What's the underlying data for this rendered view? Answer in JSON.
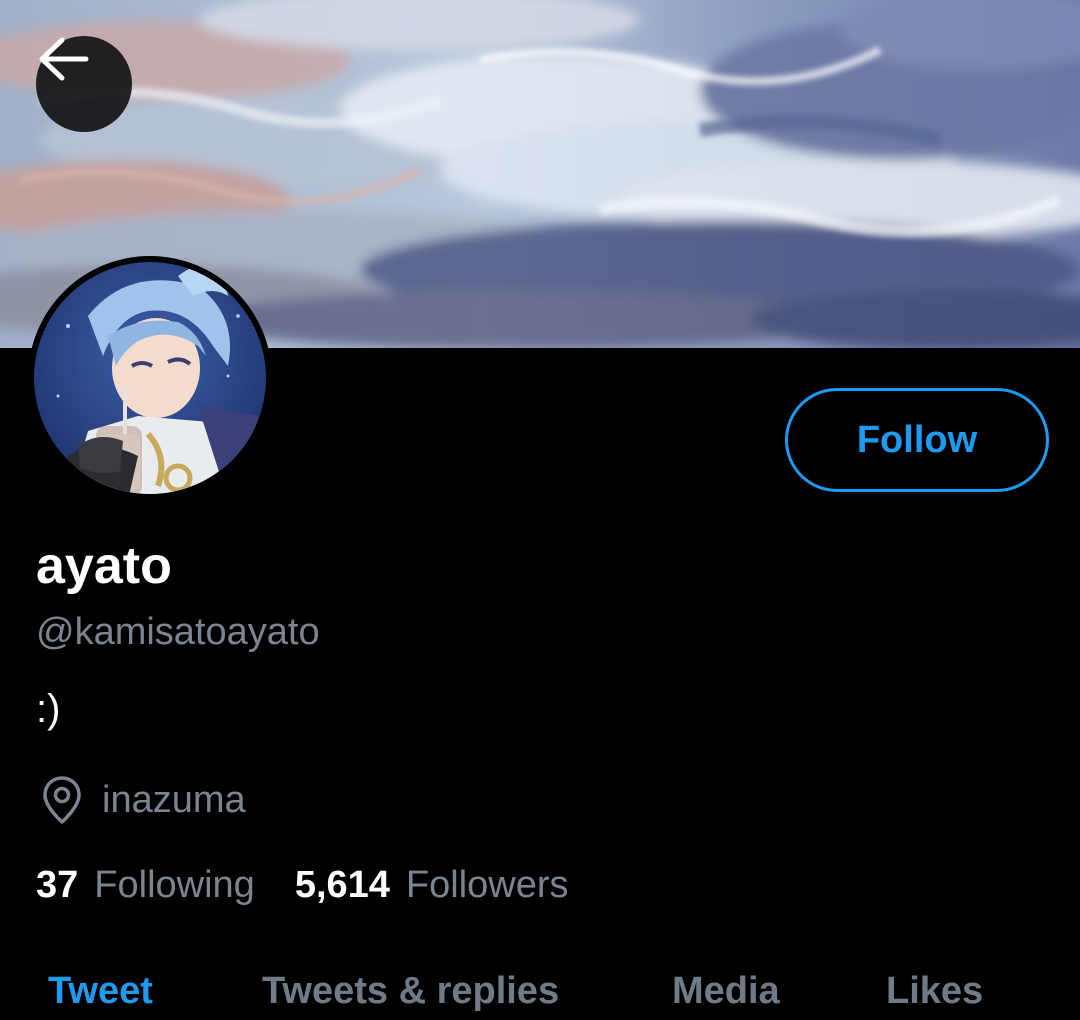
{
  "header": {
    "back_icon": "arrow-left-icon"
  },
  "profile": {
    "display_name": "ayato",
    "handle": "@kamisatoayato",
    "bio": ":)",
    "location_icon": "location-pin-icon",
    "location": "inazuma",
    "follow_label": "Follow"
  },
  "stats": {
    "following_count": "37",
    "following_label": "Following",
    "followers_count": "5,614",
    "followers_label": "Followers"
  },
  "tabs": [
    {
      "label": "Tweet",
      "active": true
    },
    {
      "label": "Tweets & replies",
      "active": false
    },
    {
      "label": "Media",
      "active": false
    },
    {
      "label": "Likes",
      "active": false
    }
  ],
  "colors": {
    "accent": "#1d9bf0",
    "background": "#000000",
    "secondary_text": "#7a8590"
  }
}
